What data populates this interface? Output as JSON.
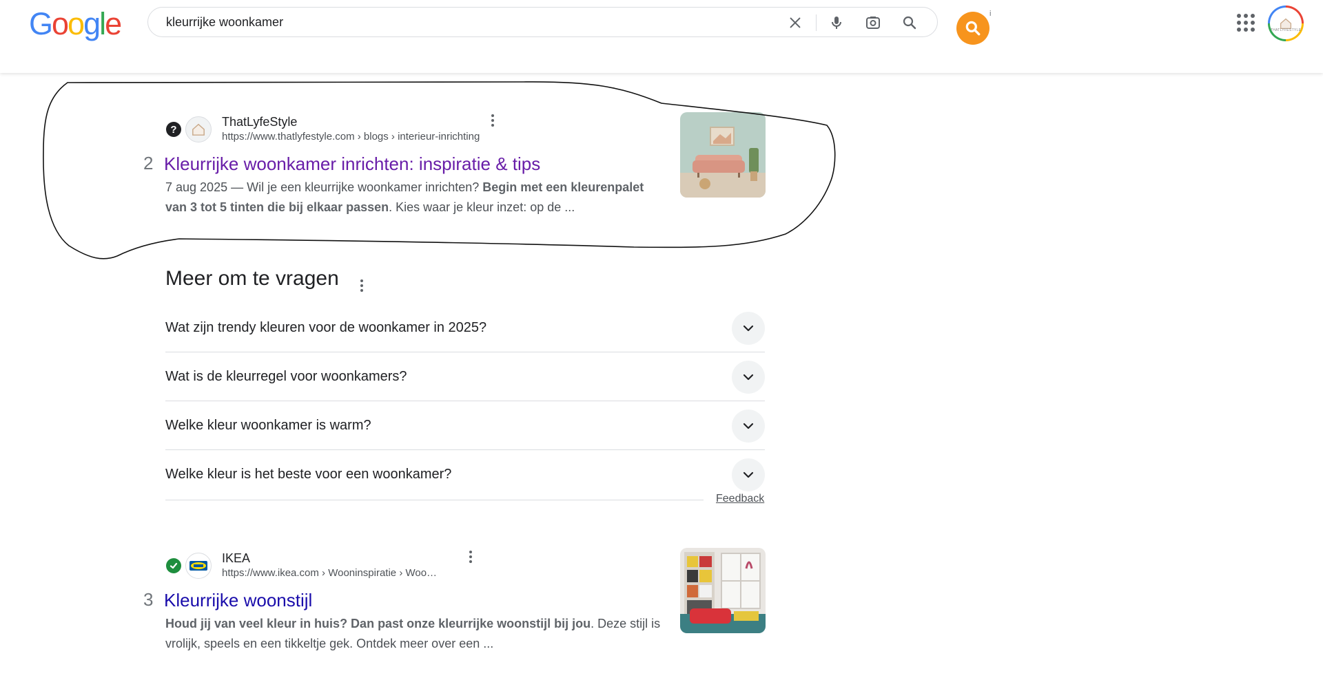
{
  "search": {
    "query": "kleurrijke woonkamer",
    "clear_icon": "close-icon",
    "voice_icon": "mic-icon",
    "lens_icon": "camera-lens-icon",
    "search_icon": "search-icon"
  },
  "logo": [
    "G",
    "o",
    "o",
    "g",
    "l",
    "e"
  ],
  "logo_colors": [
    "#4285f4",
    "#ea4335",
    "#fbbc05",
    "#4285f4",
    "#34a853",
    "#ea4335"
  ],
  "extension": {
    "icon": "search-icon",
    "info": "i",
    "color": "#f7941d"
  },
  "avatar": {
    "brand": "THATLYFESTYLE"
  },
  "results": [
    {
      "number": "2",
      "site_name": "ThatLyfeStyle",
      "url": "https://www.thatlyfestyle.com › blogs › interieur-inrichting",
      "badge_icon": "question-icon",
      "title": "Kleurrijke woonkamer inrichten: inspiratie & tips",
      "title_color": "#681da8",
      "date": "7 aug 2025 — ",
      "snippet_a": "Wil je een kleurrijke woonkamer inrichten? ",
      "snippet_bold": "Begin met een kleurenpalet van 3 tot 5 tinten die bij elkaar passen",
      "snippet_b": ". Kies waar je kleur inzet: op de ..."
    },
    {
      "number": "3",
      "site_name": "IKEA",
      "url": "https://www.ikea.com › Wooninspiratie › Woo…",
      "badge_icon": "check-icon",
      "title": "Kleurrijke woonstijl",
      "title_color": "#1a0dab",
      "snippet_bold": "Houd jij van veel kleur in huis? Dan past onze kleurrijke woonstijl bij jou",
      "snippet_b": ". Deze stijl is vrolijk, speels en een tikkeltje gek. Ontdek meer over een ..."
    }
  ],
  "paa": {
    "title": "Meer om te vragen",
    "questions": [
      "Wat zijn trendy kleuren voor de woonkamer in 2025?",
      "Wat is de kleurregel voor woonkamers?",
      "Welke kleur woonkamer is warm?",
      "Welke kleur is het beste voor een woonkamer?"
    ],
    "feedback": "Feedback"
  }
}
